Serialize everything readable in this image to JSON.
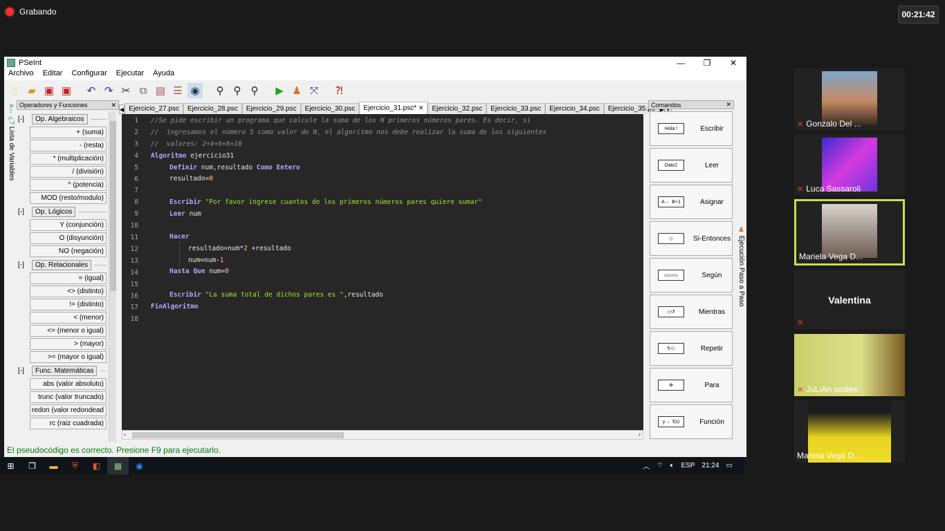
{
  "recording": {
    "label": "Grabando",
    "timer": "00:21:42"
  },
  "window": {
    "title": "PSeInt",
    "min": "—",
    "max": "❐",
    "close": "✕"
  },
  "menu": [
    "Archivo",
    "Editar",
    "Configurar",
    "Ejecutar",
    "Ayuda"
  ],
  "left_panel": {
    "title": "Operadores y Funciones",
    "close": "✕",
    "vertical_tab": "Lista de Variables",
    "vertical_icons": "a↔ ¿?",
    "groups": [
      {
        "toggle": "[-]",
        "label": "Op. Algebraicos",
        "items": [
          "+ (suma)",
          "- (resta)",
          "* (multiplicación)",
          "/ (división)",
          "^ (potencia)",
          "MOD (resto/modulo)"
        ]
      },
      {
        "toggle": "[-]",
        "label": "Op. Lógicos",
        "items": [
          "Y (conjunción)",
          "O (disyunción)",
          "NO (negación)"
        ]
      },
      {
        "toggle": "[-]",
        "label": "Op. Relacionales",
        "items": [
          "= (igual)",
          "<> (distinto)",
          "!= (distinto)",
          "< (menor)",
          "<= (menor o igual)",
          "> (mayor)",
          ">= (mayor o igual)"
        ]
      },
      {
        "toggle": "[-]",
        "label": "Func. Matemáticas",
        "items": [
          "abs (valor absoluto)",
          "trunc (valor truncado)",
          "redon (valor redondead",
          "rc (raiz cuadrada)"
        ]
      }
    ]
  },
  "tabs": [
    "Ejercicio_27.psc",
    "Ejercicio_28.psc",
    "Ejercicio_29.psc",
    "Ejercicio_30.psc",
    "Ejercicio_31.psc*",
    "Ejercicio_32.psc",
    "Ejercicio_33.psc",
    "Ejercicio_34.psc",
    "Ejercicio_35.ps"
  ],
  "tab_close": "✕",
  "code_lines": [
    "1",
    "2",
    "3",
    "4",
    "5",
    "6",
    "7",
    "8",
    "9",
    "10",
    "11",
    "12",
    "13",
    "14",
    "15",
    "16",
    "17",
    "18"
  ],
  "code": {
    "l1": "//Se pide escribir un programa que calcule la suma de los N primeros números pares. Es decir, si",
    "l2": "//  ingresamos el número 5 como valor de N, el algoritmo nos debe realizar la suma de los siguientes",
    "l3": "//  valores: 2+4+6+8+10",
    "l4_kw": "Algoritmo",
    "l4_rest": " ejercicio31",
    "l5_kw": "Definir",
    "l5_mid": " num,resultado ",
    "l5_kw2": "Como Entero",
    "l6_a": "resultado=",
    "l6_n": "0",
    "l8_kw": "Escribir",
    "l8_s": " \"Por favor ingrese cuantos de los primeros números pares quiere sumar\"",
    "l9_kw": "Leer",
    "l9_rest": " num",
    "l11_kw": "Hacer",
    "l12_a": "resultado=num*",
    "l12_n": "2",
    "l12_b": " +resultado",
    "l13_a": "num=num-",
    "l13_n": "1",
    "l14_kw": "Hasta Que",
    "l14_a": " num=",
    "l14_n": "0",
    "l16_kw": "Escribir",
    "l16_s": " \"La suma total de dichos pares es \"",
    "l16_r": ",resultado",
    "l17_kw": "FinAlgoritmo"
  },
  "right_panel": {
    "title": "Comandos",
    "close": "✕",
    "vertical_tab": "Ejecución Paso a Paso",
    "commands": [
      {
        "icon": "Hola !",
        "label": "Escribir"
      },
      {
        "icon": "Dato1",
        "label": "Leer"
      },
      {
        "icon": "A ← B+1",
        "label": "Asignar"
      },
      {
        "icon": "◇",
        "label": "Si-Entonces"
      },
      {
        "icon": "▭▭▭",
        "label": "Según"
      },
      {
        "icon": "◇↺",
        "label": "Mientras"
      },
      {
        "icon": "↻◇",
        "label": "Repetir"
      },
      {
        "icon": "⊕",
        "label": "Para"
      },
      {
        "icon": "y ← f(x)",
        "label": "Función"
      }
    ]
  },
  "status": "El pseudocódigo es correcto. Presione F9 para ejecutarlo.",
  "tray": {
    "lang": "ESP",
    "time": "21:24"
  },
  "participants": [
    {
      "name": "Gonzalo Del ..."
    },
    {
      "name": "Luca Sassaroli"
    },
    {
      "name": "Mariela Vega D..."
    },
    {
      "name": "Valentina"
    },
    {
      "name": "JuLiAn scoles"
    },
    {
      "name": "Mariela Vega D..."
    }
  ],
  "colors": {
    "editor_bg": "#272727",
    "keyword": "#b9a7ff",
    "string": "#a6e22e",
    "number": "#ffc66d",
    "highlight": "#c8e04a"
  }
}
